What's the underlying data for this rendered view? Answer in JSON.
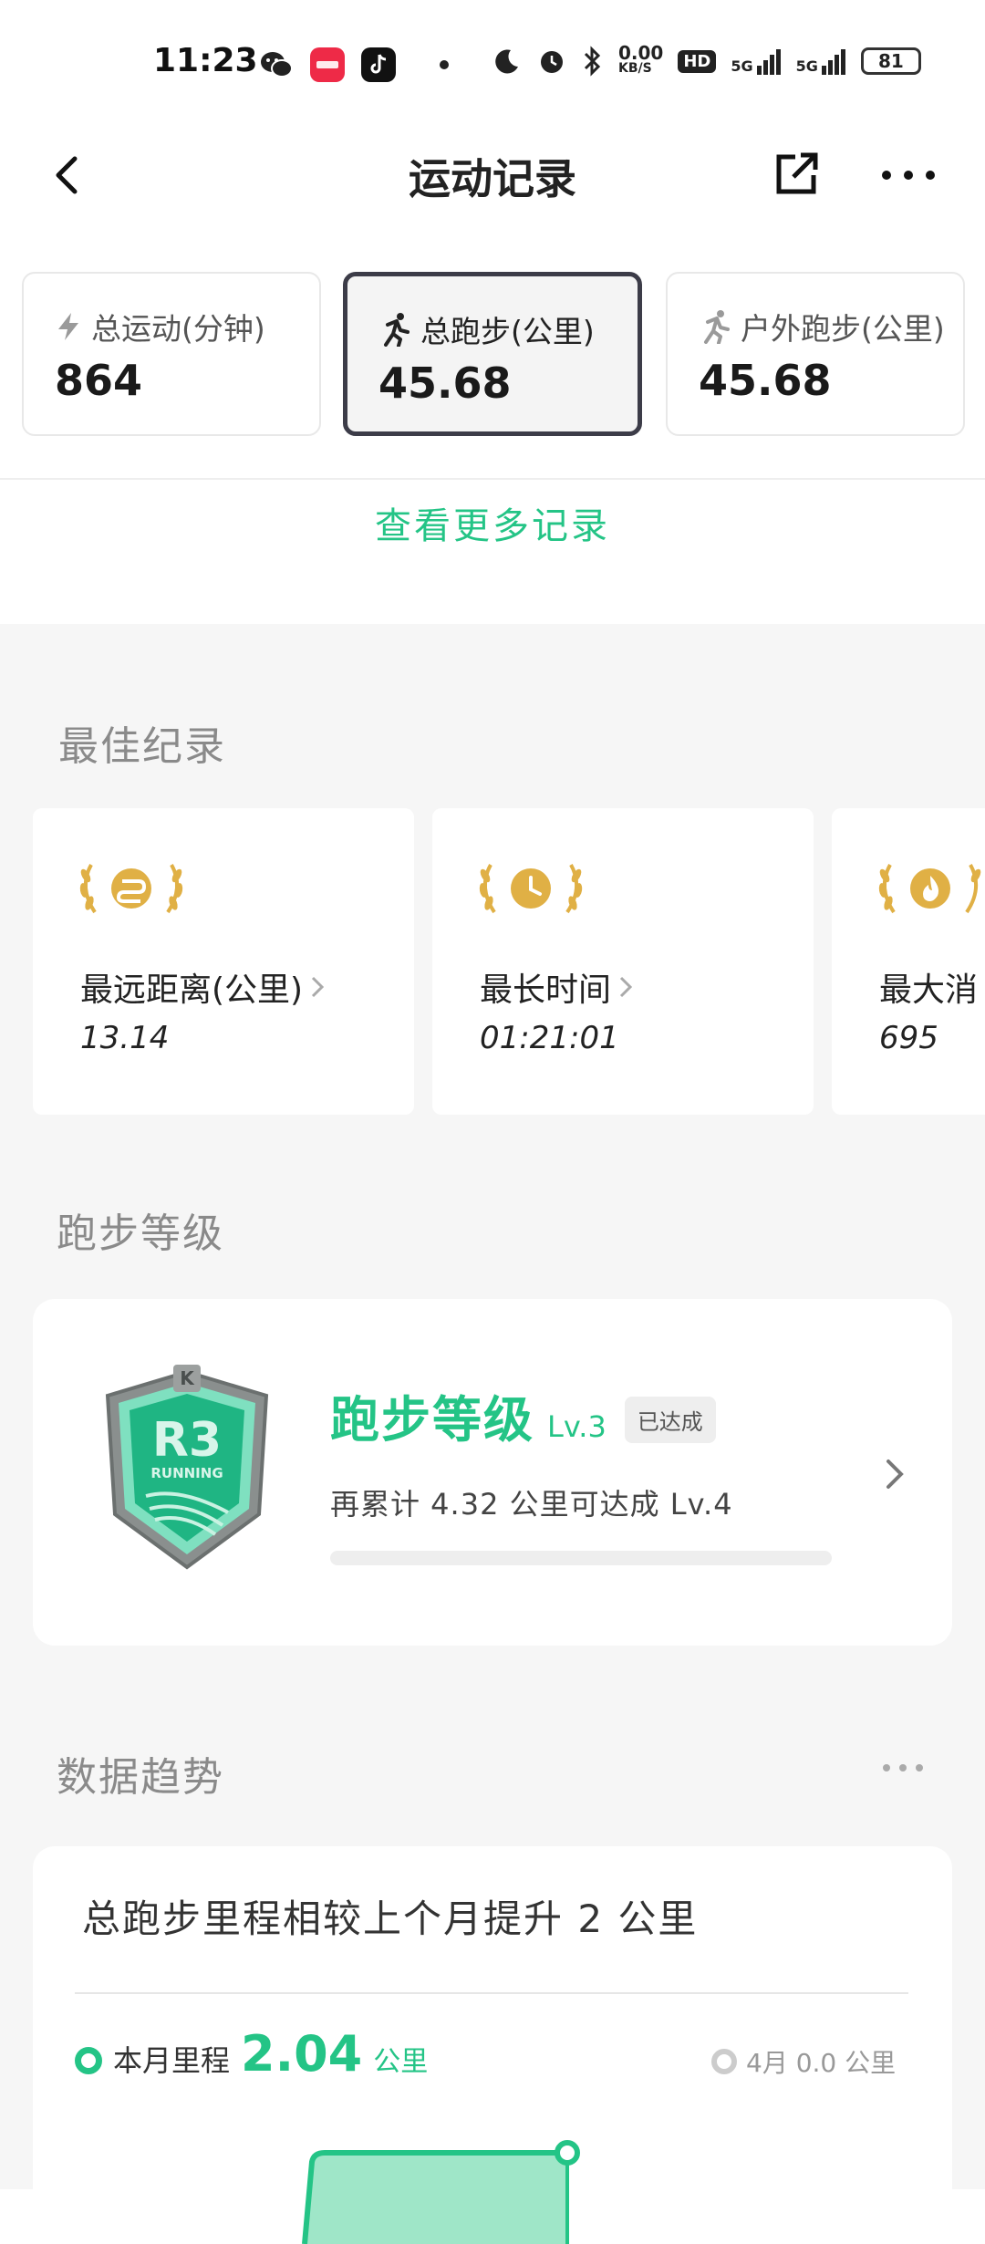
{
  "status_bar": {
    "time": "11:23",
    "net_speed_value": "0.00",
    "net_speed_unit": "KB/S",
    "hd": "HD",
    "signal1": "5G",
    "signal2": "5G",
    "battery": "81"
  },
  "header": {
    "title": "运动记录"
  },
  "stats": [
    {
      "label": "总运动(分钟)",
      "value": "864",
      "icon": "bolt-icon"
    },
    {
      "label": "总跑步(公里)",
      "value": "45.68",
      "icon": "runner-icon"
    },
    {
      "label": "户外跑步(公里)",
      "value": "45.68",
      "icon": "runner-icon"
    }
  ],
  "more_records": "查看更多记录",
  "best": {
    "title": "最佳纪录",
    "items": [
      {
        "label": "最远距离(公里)",
        "value": "13.14",
        "icon": "route-icon"
      },
      {
        "label": "最长时间",
        "value": "01:21:01",
        "icon": "clock-icon"
      },
      {
        "label": "最大消",
        "value": "695",
        "icon": "flame-icon"
      }
    ]
  },
  "level": {
    "section_title": "跑步等级",
    "title": "跑步等级",
    "lv": "Lv.3",
    "status": "已达成",
    "desc": "再累计 4.32 公里可达成 Lv.4",
    "badge_text": "R3",
    "badge_sub": "RUNNING",
    "progress": 0
  },
  "trend": {
    "section_title": "数据趋势",
    "headline": "总跑步里程相较上个月提升 2 公里",
    "month_label": "本月里程",
    "month_value": "2.04",
    "month_unit": "公里",
    "prev_label": "4月 0.0 公里"
  },
  "colors": {
    "accent": "#24c486",
    "gold": "#e0b045",
    "active_border": "#3c3c48"
  }
}
